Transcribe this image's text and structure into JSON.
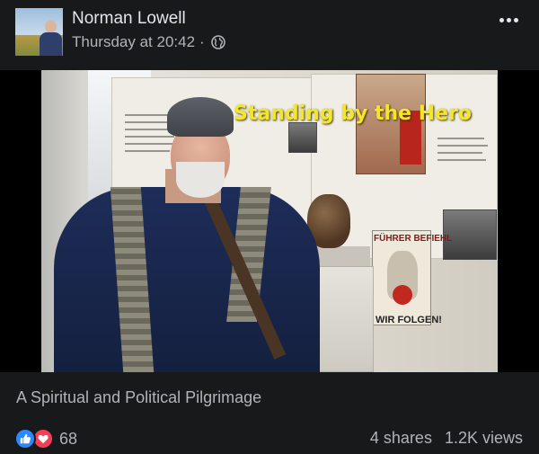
{
  "post": {
    "author": "Norman Lowell",
    "timestamp": "Thursday at 20:42",
    "separator": "·",
    "audience_icon": "globe-icon",
    "more_icon": "more-options-icon"
  },
  "video": {
    "caption": "Standing by the Hero",
    "poster_text_top": "FÜHRER BEFIEHL",
    "poster_text_bottom": "WIR FOLGEN!"
  },
  "footer": {
    "title": "A Spiritual and Political Pilgrimage",
    "reaction_count": "68",
    "shares": "4 shares",
    "views": "1.2K views"
  },
  "colors": {
    "background": "#18191a",
    "primary_text": "#e4e6eb",
    "secondary_text": "#b0b3b8",
    "like_blue": "#2d88ff",
    "love_red": "#f33e58",
    "caption_yellow": "#f5e629"
  }
}
